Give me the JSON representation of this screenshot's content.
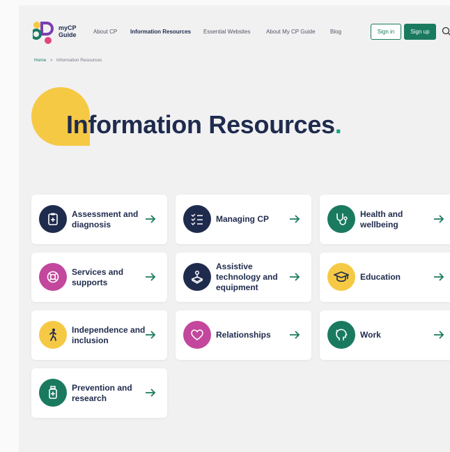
{
  "header": {
    "logo_line1": "myCP",
    "logo_line2": "Guide",
    "nav": [
      "About CP",
      "Information Resources",
      "Essential Websites",
      "About My CP Guide",
      "Blog"
    ],
    "sign_in": "Sign in",
    "sign_up": "Sign up"
  },
  "breadcrumb": {
    "home": "Home",
    "separator": ">",
    "current": "Information Resources"
  },
  "hero": {
    "title": "Information Resources",
    "dot": "."
  },
  "colors": {
    "navy": "#1f2b4d",
    "green": "#1a7a5f",
    "yellow": "#f6c945",
    "pink": "#c3479c"
  },
  "cards": [
    {
      "label": "Assessment and diagnosis",
      "icon": "clipboard-icon",
      "color": "#1f2b4d"
    },
    {
      "label": "Managing CP",
      "icon": "checklist-icon",
      "color": "#1f2b4d"
    },
    {
      "label": "Health and wellbeing",
      "icon": "stethoscope-icon",
      "color": "#1a7a5f"
    },
    {
      "label": "Services and supports",
      "icon": "lifebuoy-icon",
      "color": "#c3479c"
    },
    {
      "label": "Assistive technology and equipment",
      "icon": "joystick-icon",
      "color": "#1f2b4d"
    },
    {
      "label": "Education",
      "icon": "graduation-cap-icon",
      "color": "#f6c945"
    },
    {
      "label": "Independence and inclusion",
      "icon": "walking-person-icon",
      "color": "#f6c945"
    },
    {
      "label": "Relationships",
      "icon": "heart-icon",
      "color": "#c3479c"
    },
    {
      "label": "Work",
      "icon": "head-icon",
      "color": "#1a7a5f"
    },
    {
      "label": "Prevention and research",
      "icon": "medicine-bottle-icon",
      "color": "#1a7a5f"
    }
  ]
}
